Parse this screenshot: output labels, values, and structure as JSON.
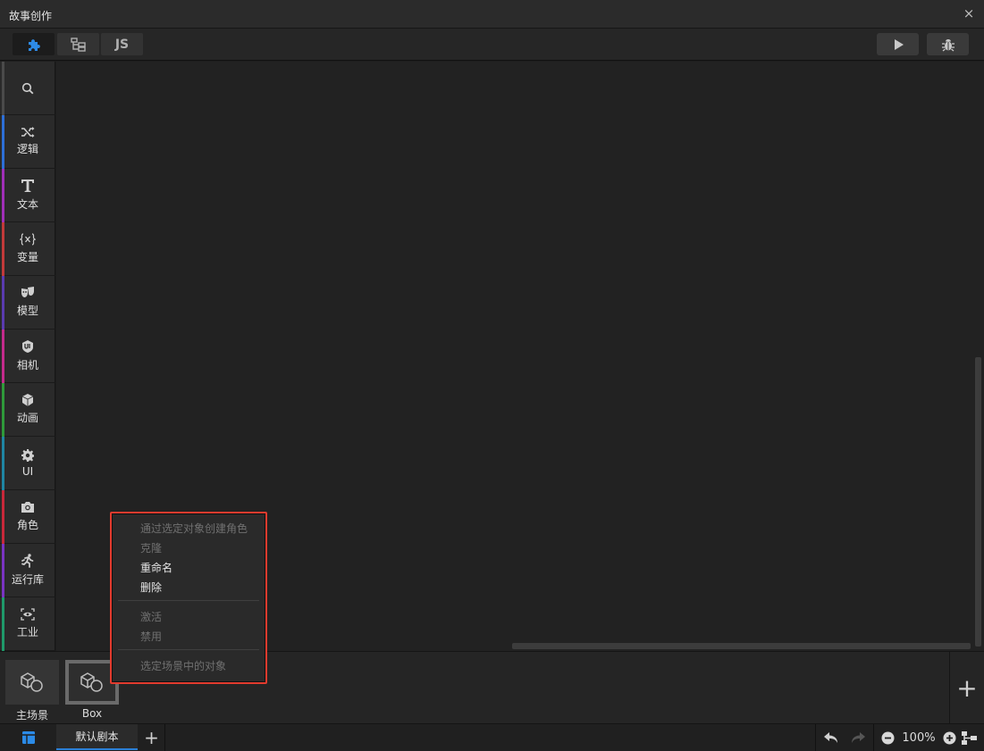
{
  "window": {
    "title": "故事创作",
    "close_label": "×"
  },
  "toolbar": {
    "tabs": [
      {
        "icon": "puzzle-icon",
        "active": true
      },
      {
        "icon": "tree-structure-icon",
        "active": false
      },
      {
        "label": "JS",
        "active": false
      }
    ],
    "right_buttons": [
      {
        "icon": "play-icon"
      },
      {
        "icon": "bug-icon"
      }
    ]
  },
  "sidebar": {
    "items": [
      {
        "icon": "search-icon",
        "label": "",
        "color": "#4a4a4a"
      },
      {
        "icon": "shuffle-icon",
        "label": "逻辑",
        "color": "#2d6fd8"
      },
      {
        "icon": "text-t-icon",
        "label": "文本",
        "color": "#a02fb8"
      },
      {
        "icon": "variable-icon",
        "label": "变量",
        "color": "#c23a3a"
      },
      {
        "icon": "theater-mask-icon",
        "label": "模型",
        "color": "#5a3bb0"
      },
      {
        "icon": "ui-badge-icon",
        "label": "相机",
        "color": "#c42b8c"
      },
      {
        "icon": "cube-icon",
        "label": "动画",
        "color": "#2f9a3a"
      },
      {
        "icon": "gear-icon",
        "label": "UI",
        "color": "#1f86a3"
      },
      {
        "icon": "camera-icon",
        "label": "角色",
        "color": "#c8283a"
      },
      {
        "icon": "running-person-icon",
        "label": "运行库",
        "color": "#7a33c2"
      },
      {
        "icon": "eye-scan-icon",
        "label": "工业",
        "color": "#1f9a6a"
      }
    ]
  },
  "scenes": [
    {
      "label": "主场景",
      "selected": false
    },
    {
      "label": "Box",
      "selected": true
    }
  ],
  "context_menu": {
    "items": [
      {
        "label": "通过选定对象创建角色",
        "enabled": false
      },
      {
        "label": "克隆",
        "enabled": false
      },
      {
        "label": "重命名",
        "enabled": true
      },
      {
        "label": "删除",
        "enabled": true
      },
      {
        "label": "激活",
        "enabled": false
      },
      {
        "label": "禁用",
        "enabled": false
      },
      {
        "label": "选定场景中的对象",
        "enabled": false
      }
    ]
  },
  "statusbar": {
    "script_tab": "默认剧本",
    "add_label": "+",
    "zoom": "100%"
  },
  "bottom": {
    "add_scene_label": "+"
  }
}
